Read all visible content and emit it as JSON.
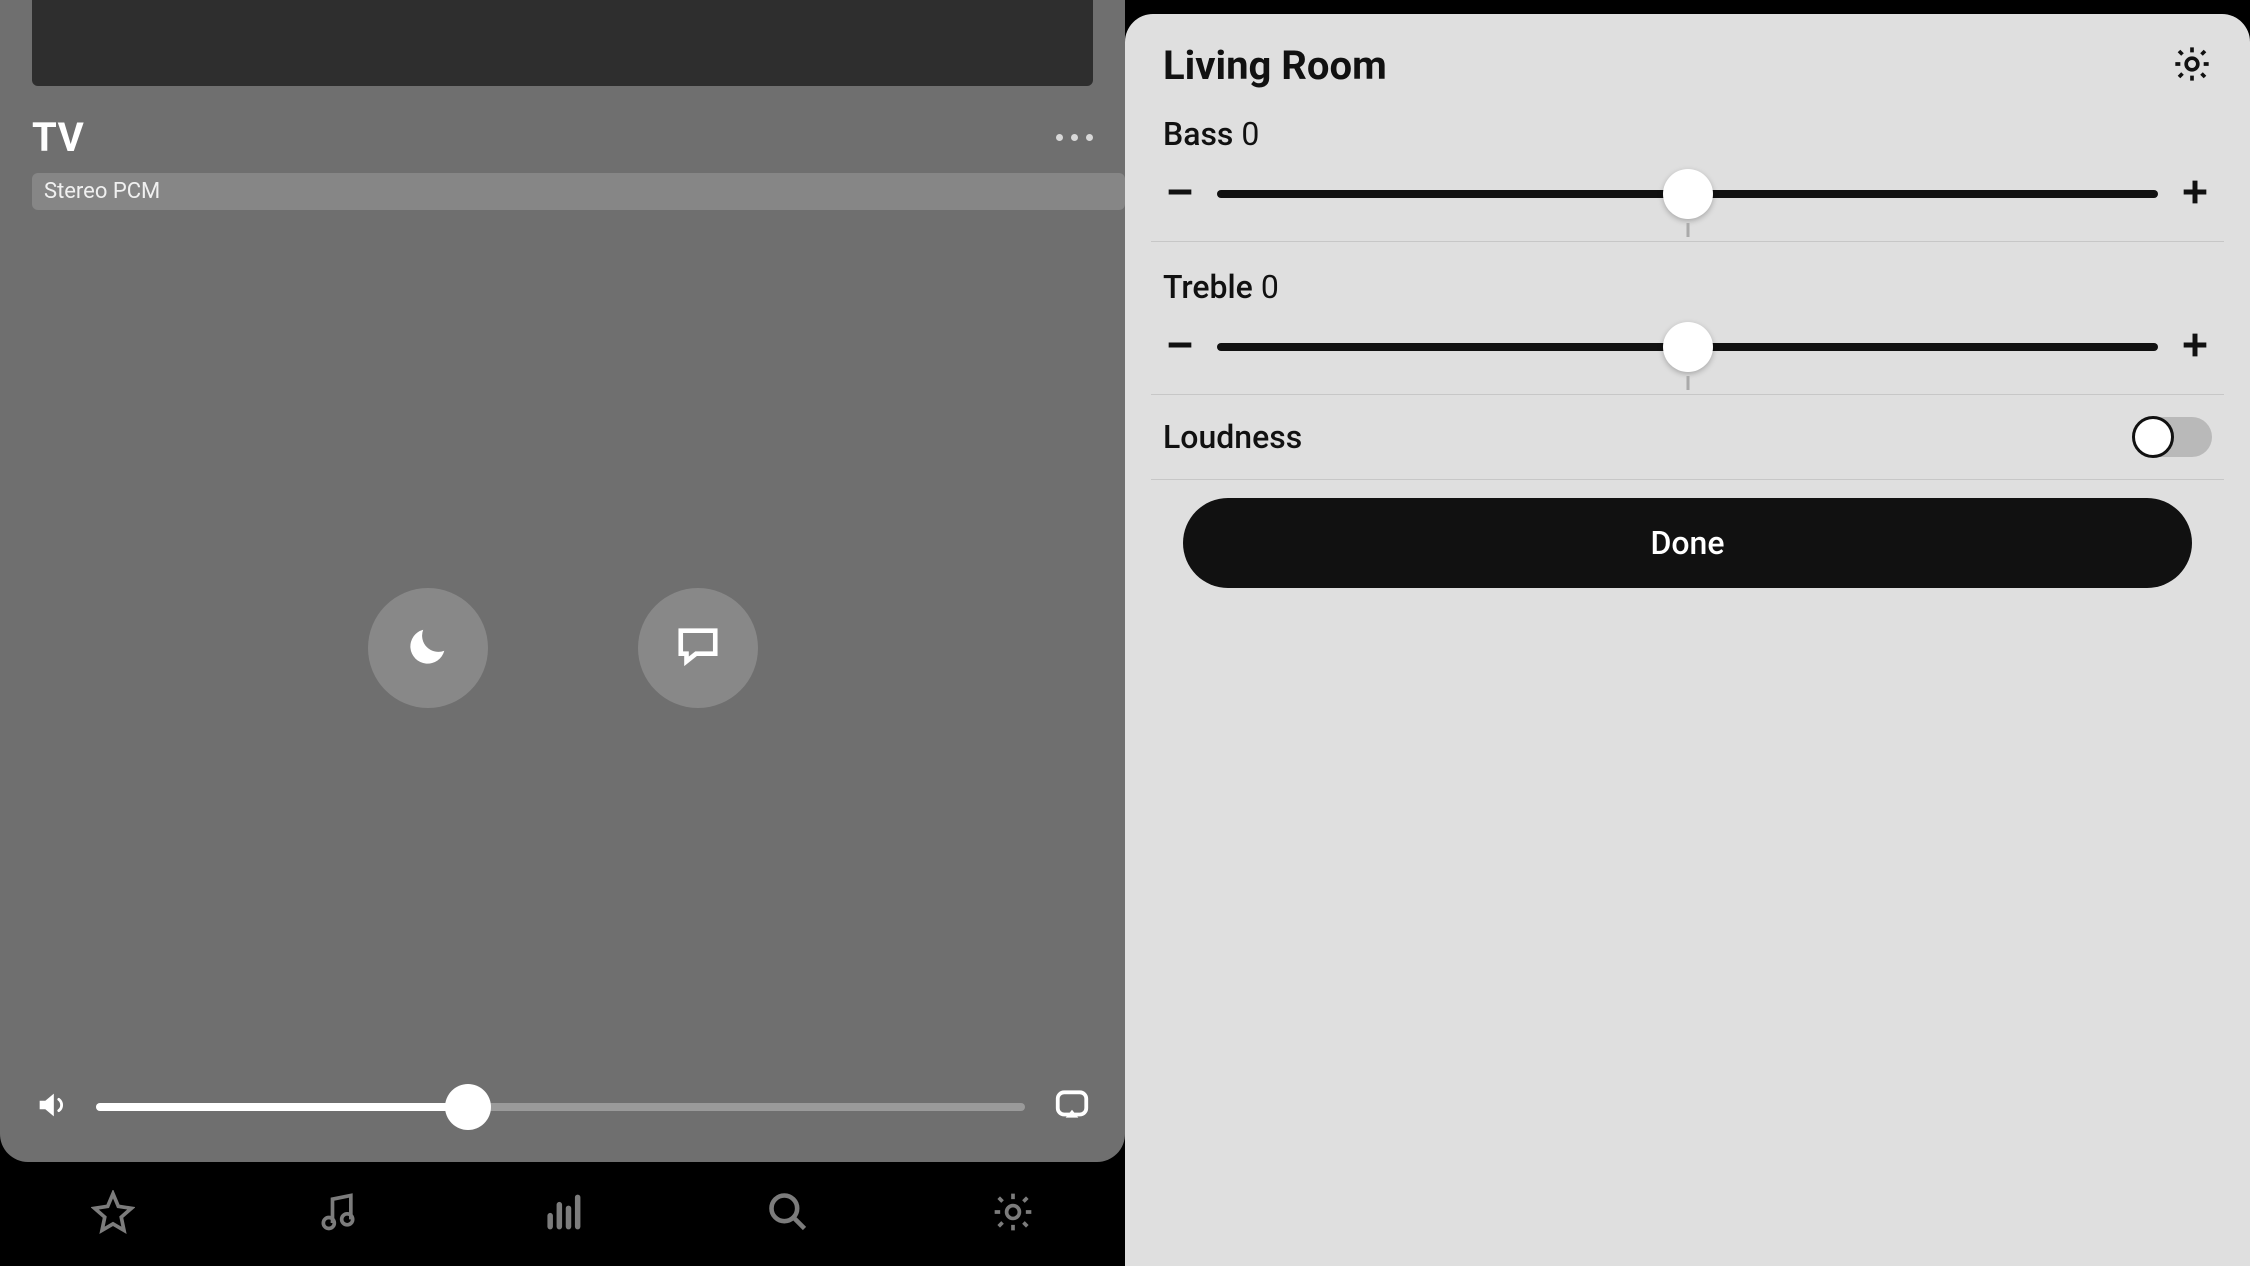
{
  "left": {
    "title": "TV",
    "badge": "Stereo PCM",
    "volume_percent": 40
  },
  "right": {
    "room": "Living Room",
    "bass": {
      "label": "Bass",
      "value": "0",
      "percent": 50
    },
    "treble": {
      "label": "Treble",
      "value": "0",
      "percent": 50
    },
    "loudness": {
      "label": "Loudness",
      "on": false
    },
    "done_label": "Done"
  }
}
